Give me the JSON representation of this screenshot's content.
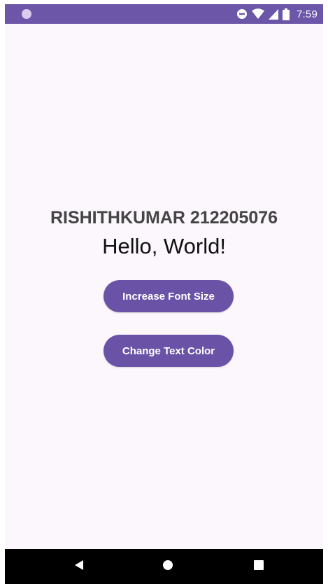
{
  "status_bar": {
    "time": "7:59",
    "icons": [
      "notification-dot-icon",
      "do-not-disturb-icon",
      "wifi-icon",
      "signal-icon",
      "battery-icon"
    ]
  },
  "main": {
    "name_text": "RISHITHKUMAR 212205076",
    "hello_text": "Hello, World!",
    "increase_button_label": "Increase Font Size",
    "change_color_button_label": "Change Text Color"
  },
  "nav_bar": {
    "icons": [
      "back-icon",
      "home-icon",
      "recents-icon"
    ]
  },
  "colors": {
    "accent": "#6a53a6",
    "status_bar": "#6b56a8",
    "background": "#fcf6fd",
    "nav_bar": "#000000"
  }
}
